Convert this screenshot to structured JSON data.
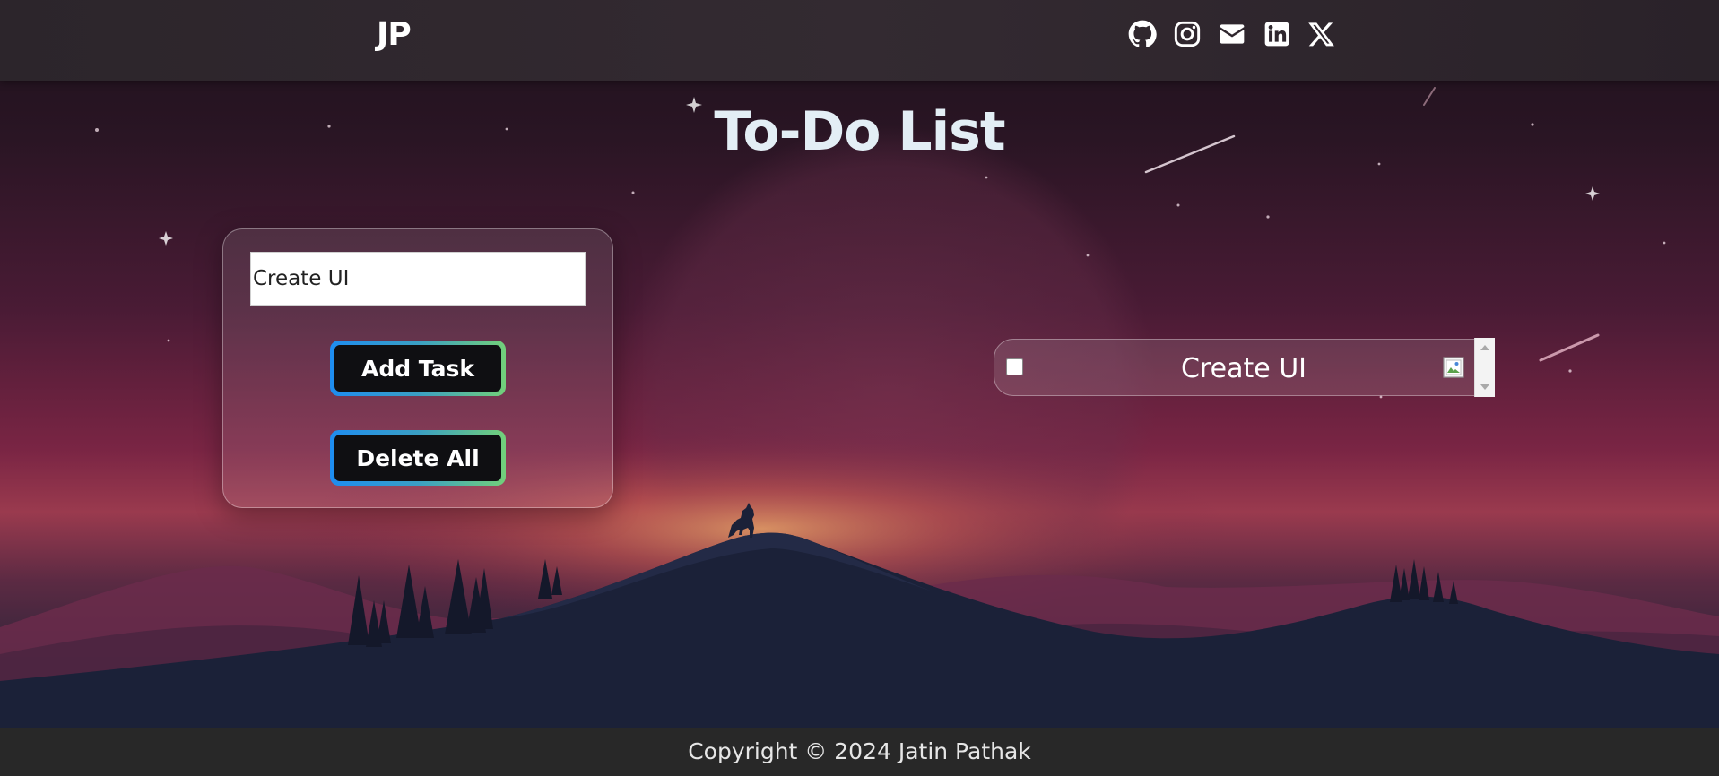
{
  "header": {
    "logo": "JP",
    "social_links": [
      {
        "icon": "github-icon",
        "label": "GitHub"
      },
      {
        "icon": "instagram-icon",
        "label": "Instagram"
      },
      {
        "icon": "mail-icon",
        "label": "Email"
      },
      {
        "icon": "linkedin-icon",
        "label": "LinkedIn"
      },
      {
        "icon": "x-icon",
        "label": "X"
      }
    ]
  },
  "main": {
    "title": "To-Do List",
    "input": {
      "value": "Create UI",
      "placeholder": ""
    },
    "add_button_label": "Add Task",
    "delete_all_button_label": "Delete All",
    "tasks": [
      {
        "text": "Create UI",
        "checked": false
      }
    ]
  },
  "footer": {
    "copyright": "Copyright © 2024 Jatin Pathak"
  },
  "colors": {
    "header_bg": "#2f272e",
    "footer_bg": "#282828",
    "title": "#e3eef5",
    "button_bg": "#0f0f12",
    "button_border_start": "#1e8df0",
    "button_border_end": "#72d07a"
  }
}
